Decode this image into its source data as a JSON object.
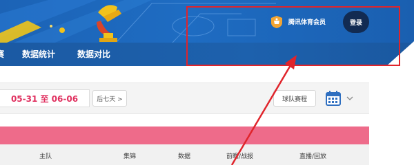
{
  "nav": {
    "partial_item": "赛",
    "items": [
      "数据统计",
      "数据对比"
    ]
  },
  "header": {
    "member_label": "腾讯体育会员",
    "login_label": "登录"
  },
  "toolbar": {
    "date_range": "05-31 至 06-06",
    "next_week_label": "后七天 >",
    "schedule_label": "球队赛程"
  },
  "table": {
    "columns": [
      "主队",
      "集锦",
      "数据",
      "前瞻/战报",
      "直播/回放"
    ]
  },
  "colors": {
    "banner_blue": "#1e6cc2",
    "nav_blue": "#1b5aa3",
    "date_pink": "#e0305f",
    "strip_pink": "#ee6b8a",
    "login_dark": "#122b52",
    "annotation_red": "#e0242b"
  },
  "icons": [
    "trophy-icon",
    "member-badge-icon",
    "calendar-icon",
    "chevron-down-icon"
  ]
}
